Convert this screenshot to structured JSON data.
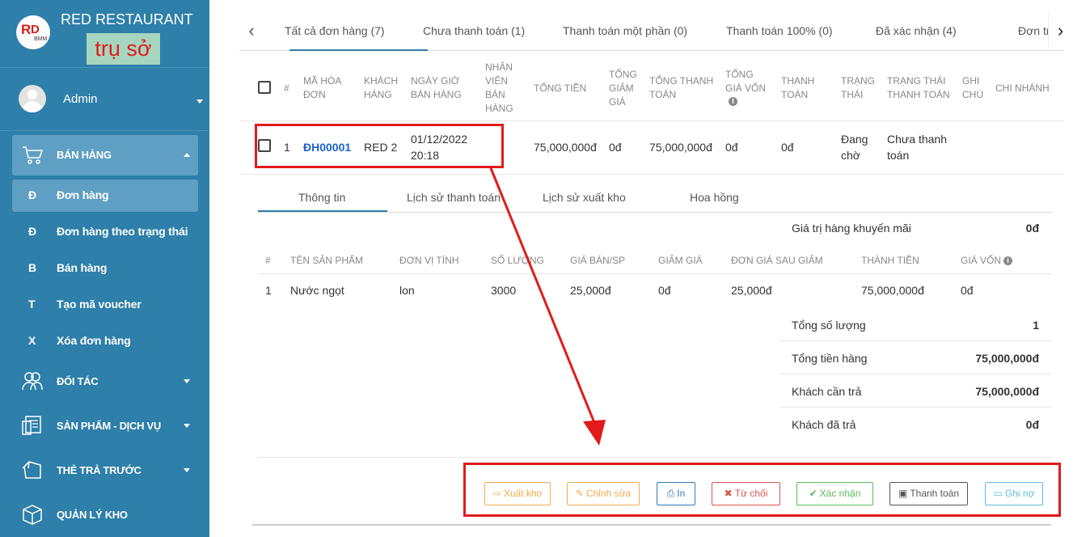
{
  "brand": {
    "name": "RED RESTAURANT",
    "branch": "trụ sở",
    "logo_text_1": "R",
    "logo_text_2": "D",
    "logo_text_3": "BMM"
  },
  "user": {
    "name": "Admin"
  },
  "sidebar": {
    "sections": [
      {
        "label": "BÁN HÀNG",
        "icon": "cart-icon"
      },
      {
        "label": "ĐỐI TÁC",
        "icon": "partners-icon"
      },
      {
        "label": "SẢN PHẨM - DỊCH VỤ",
        "icon": "products-icon"
      },
      {
        "label": "THẺ TRẢ TRƯỚC",
        "icon": "prepaid-card-icon"
      },
      {
        "label": "QUẢN LÝ KHO",
        "icon": "warehouse-box-icon"
      }
    ],
    "subitems": [
      {
        "letter": "Đ",
        "label": "Đơn hàng"
      },
      {
        "letter": "Đ",
        "label": "Đơn hàng theo trạng thái"
      },
      {
        "letter": "B",
        "label": "Bán hàng"
      },
      {
        "letter": "T",
        "label": "Tạo mã voucher"
      },
      {
        "letter": "X",
        "label": "Xóa đơn hàng"
      }
    ]
  },
  "status_tabs": {
    "prev": "‹",
    "next": "›",
    "items": [
      "Tất cả đơn hàng (7)",
      "Chưa thanh toán (1)",
      "Thanh toán một phần (0)",
      "Thanh toán 100% (0)",
      "Đã xác nhận (4)",
      "Đơn trả"
    ]
  },
  "table": {
    "headers": {
      "num": "#",
      "code": [
        "MÃ HÓA",
        "ĐƠN"
      ],
      "customer": [
        "KHÁCH",
        "HÀNG"
      ],
      "date": [
        "NGÀY GIỜ",
        "BÁN HÀNG"
      ],
      "staff": [
        "NHÂN",
        "VIÊN",
        "BÁN",
        "HÀNG"
      ],
      "total": "TỔNG TIỀN",
      "discount": [
        "TỔNG",
        "GIẢM",
        "GIÁ"
      ],
      "payment": [
        "TỔNG THANH",
        "TOÁN"
      ],
      "cost": [
        "TỔNG",
        "GIÁ VỐN"
      ],
      "paid": [
        "THANH",
        "TOÁN"
      ],
      "status": [
        "TRẠNG",
        "THÁI"
      ],
      "pay_status": [
        "TRẠNG THÁI",
        "THANH TOÁN"
      ],
      "note": [
        "GHI",
        "CHÚ"
      ],
      "branch": "CHI NHÁNH"
    },
    "row": {
      "num": "1",
      "code": "ĐH00001",
      "customer": "RED 2",
      "date": "01/12/2022",
      "time": "20:18",
      "total": "75,000,000đ",
      "discount": "0đ",
      "payment": "75,000,000đ",
      "cost": "0đ",
      "paid": "0đ",
      "status": [
        "Đang",
        "chờ"
      ],
      "pay_status": [
        "Chưa thanh",
        "toán"
      ]
    }
  },
  "detail": {
    "tabs": [
      "Thông tin",
      "Lịch sử thanh toán",
      "Lịch sử xuất kho",
      "Hoa hồng"
    ],
    "promo_label": "Giá trị hàng khuyến mãi",
    "promo_value": "0đ",
    "item_headers": [
      "#",
      "TÊN SẢN PHẨM",
      "ĐƠN VỊ TÍNH",
      "SỐ LƯỢNG",
      "GIÁ BÁN/SP",
      "GIẢM GIÁ",
      "ĐƠN GIÁ SAU GIẢM",
      "THÀNH TIỀN",
      "GIÁ VỐN"
    ],
    "item": {
      "num": "1",
      "name": "Nước ngọt",
      "unit": "lon",
      "qty": "3000",
      "price": "25,000đ",
      "discount": "0đ",
      "net_price": "25,000đ",
      "amount": "75,000,000đ",
      "cost": "0đ"
    },
    "summary": [
      {
        "label": "Tổng số lượng",
        "value": "1"
      },
      {
        "label": "Tổng tiền hàng",
        "value": "75,000,000đ"
      },
      {
        "label": "Khách cần trả",
        "value": "75,000,000đ"
      },
      {
        "label": "Khách đã trả",
        "value": "0đ"
      }
    ]
  },
  "actions": [
    {
      "label": "Xuất kho",
      "icon": "⇨",
      "color": "#f0ad4e"
    },
    {
      "label": "Chỉnh sửa",
      "icon": "✎",
      "color": "#f0ad4e"
    },
    {
      "label": "In",
      "icon": "⎙",
      "color": "#337ab7"
    },
    {
      "label": "Từ chối",
      "icon": "✖",
      "color": "#d9534f"
    },
    {
      "label": "Xác nhận",
      "icon": "✔",
      "color": "#5cb85c"
    },
    {
      "label": "Thanh toán",
      "icon": "▣",
      "color": "#555555"
    },
    {
      "label": "Ghi nợ",
      "icon": "▭",
      "color": "#5bc0de"
    }
  ],
  "colors": {
    "sidebar": "#2e7fa9",
    "sidebar_active": "#5f9fc3",
    "highlight": "#e11b1b",
    "link": "#1e63c8"
  }
}
